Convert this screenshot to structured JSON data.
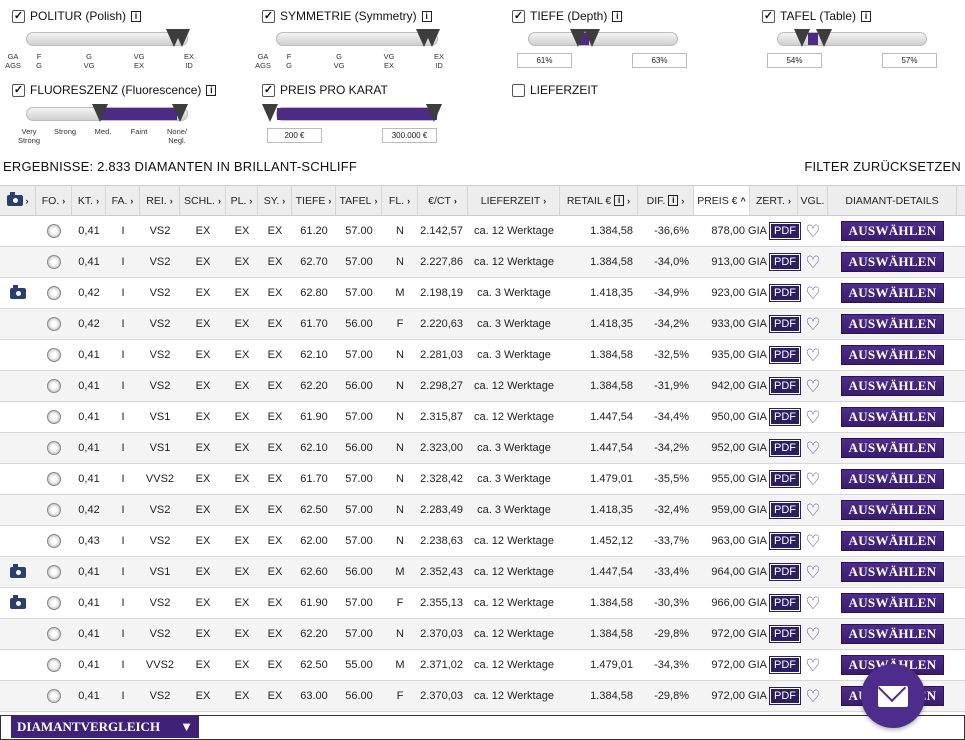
{
  "filters": {
    "politur": {
      "label": "POLITUR (Polish)",
      "ticks_top": [
        "GA",
        "F",
        "G",
        "VG",
        "EX"
      ],
      "ticks_bottom": [
        "AGS",
        "G",
        "VG",
        "EX",
        "ID"
      ]
    },
    "symmetrie": {
      "label": "SYMMETRIE (Symmetry)",
      "ticks_top": [
        "GA",
        "F",
        "G",
        "VG",
        "EX"
      ],
      "ticks_bottom": [
        "AGS",
        "G",
        "VG",
        "EX",
        "ID"
      ]
    },
    "tiefe": {
      "label": "TIEFE (Depth)",
      "min": "61%",
      "max": "63%"
    },
    "tafel": {
      "label": "TAFEL (Table)",
      "min": "54%",
      "max": "57%"
    },
    "fluoreszenz": {
      "label": "FLUORESZENZ (Fluorescence)",
      "ticks": [
        "Very\nStrong",
        "Strong",
        "Med.",
        "Faint",
        "None/\nNegl."
      ]
    },
    "preis": {
      "label": "PREIS PRO KARAT",
      "min": "200 €",
      "max": "300.000 €"
    },
    "lieferzeit": {
      "label": "LIEFERZEIT"
    }
  },
  "results_title": "ERGEBNISSE: 2.833 DIAMANTEN IN BRILLANT-SCHLIFF",
  "reset_label": "FILTER ZURÜCKSETZEN",
  "columns": [
    "FO.",
    "KT.",
    "FA.",
    "REI.",
    "SCHL.",
    "PL.",
    "SY.",
    "TIEFE",
    "TAFEL",
    "FL.",
    "€/CT",
    "LIEFERZEIT",
    "RETAIL €",
    "DIF.",
    "PREIS €",
    "ZERT.",
    "VGL.",
    "DIAMANT-DETAILS"
  ],
  "rows": [
    {
      "cam": false,
      "kt": "0,41",
      "fa": "I",
      "rei": "VS2",
      "schl": "EX",
      "pl": "EX",
      "sy": "EX",
      "tiefe": "61.20",
      "tafel": "57.00",
      "fl": "N",
      "ct": "2.142,57",
      "lz": "ca. 12 Werktage",
      "retail": "1.384,58",
      "dif": "-36,6%",
      "preis": "878,00"
    },
    {
      "cam": false,
      "kt": "0,41",
      "fa": "I",
      "rei": "VS2",
      "schl": "EX",
      "pl": "EX",
      "sy": "EX",
      "tiefe": "62.70",
      "tafel": "57.00",
      "fl": "N",
      "ct": "2.227,86",
      "lz": "ca. 12 Werktage",
      "retail": "1.384,58",
      "dif": "-34,0%",
      "preis": "913,00"
    },
    {
      "cam": true,
      "kt": "0,42",
      "fa": "I",
      "rei": "VS2",
      "schl": "EX",
      "pl": "EX",
      "sy": "EX",
      "tiefe": "62.80",
      "tafel": "57.00",
      "fl": "M",
      "ct": "2.198,19",
      "lz": "ca. 3 Werktage",
      "retail": "1.418,35",
      "dif": "-34,9%",
      "preis": "923,00"
    },
    {
      "cam": false,
      "kt": "0,42",
      "fa": "I",
      "rei": "VS2",
      "schl": "EX",
      "pl": "EX",
      "sy": "EX",
      "tiefe": "61.70",
      "tafel": "56.00",
      "fl": "F",
      "ct": "2.220,63",
      "lz": "ca. 3 Werktage",
      "retail": "1.418,35",
      "dif": "-34,2%",
      "preis": "933,00"
    },
    {
      "cam": false,
      "kt": "0,41",
      "fa": "I",
      "rei": "VS2",
      "schl": "EX",
      "pl": "EX",
      "sy": "EX",
      "tiefe": "62.10",
      "tafel": "57.00",
      "fl": "N",
      "ct": "2.281,03",
      "lz": "ca. 3 Werktage",
      "retail": "1.384,58",
      "dif": "-32,5%",
      "preis": "935,00"
    },
    {
      "cam": false,
      "kt": "0,41",
      "fa": "I",
      "rei": "VS2",
      "schl": "EX",
      "pl": "EX",
      "sy": "EX",
      "tiefe": "62.20",
      "tafel": "56.00",
      "fl": "N",
      "ct": "2.298,27",
      "lz": "ca. 12 Werktage",
      "retail": "1.384,58",
      "dif": "-31,9%",
      "preis": "942,00"
    },
    {
      "cam": false,
      "kt": "0,41",
      "fa": "I",
      "rei": "VS1",
      "schl": "EX",
      "pl": "EX",
      "sy": "EX",
      "tiefe": "61.90",
      "tafel": "57.00",
      "fl": "N",
      "ct": "2.315,87",
      "lz": "ca. 12 Werktage",
      "retail": "1.447,54",
      "dif": "-34,4%",
      "preis": "950,00"
    },
    {
      "cam": false,
      "kt": "0,41",
      "fa": "I",
      "rei": "VS1",
      "schl": "EX",
      "pl": "EX",
      "sy": "EX",
      "tiefe": "62.10",
      "tafel": "56.00",
      "fl": "N",
      "ct": "2.323,00",
      "lz": "ca. 3 Werktage",
      "retail": "1.447,54",
      "dif": "-34,2%",
      "preis": "952,00"
    },
    {
      "cam": false,
      "kt": "0,41",
      "fa": "I",
      "rei": "VVS2",
      "schl": "EX",
      "pl": "EX",
      "sy": "EX",
      "tiefe": "61.70",
      "tafel": "57.00",
      "fl": "N",
      "ct": "2.328,42",
      "lz": "ca. 3 Werktage",
      "retail": "1.479,01",
      "dif": "-35,5%",
      "preis": "955,00"
    },
    {
      "cam": false,
      "kt": "0,42",
      "fa": "I",
      "rei": "VS2",
      "schl": "EX",
      "pl": "EX",
      "sy": "EX",
      "tiefe": "62.50",
      "tafel": "57.00",
      "fl": "N",
      "ct": "2.283,49",
      "lz": "ca. 3 Werktage",
      "retail": "1.418,35",
      "dif": "-32,4%",
      "preis": "959,00"
    },
    {
      "cam": false,
      "kt": "0,43",
      "fa": "I",
      "rei": "VS2",
      "schl": "EX",
      "pl": "EX",
      "sy": "EX",
      "tiefe": "62.00",
      "tafel": "57.00",
      "fl": "N",
      "ct": "2.238,63",
      "lz": "ca. 12 Werktage",
      "retail": "1.452,12",
      "dif": "-33,7%",
      "preis": "963,00"
    },
    {
      "cam": true,
      "kt": "0,41",
      "fa": "I",
      "rei": "VS1",
      "schl": "EX",
      "pl": "EX",
      "sy": "EX",
      "tiefe": "62.60",
      "tafel": "56.00",
      "fl": "M",
      "ct": "2.352,43",
      "lz": "ca. 12 Werktage",
      "retail": "1.447,54",
      "dif": "-33,4%",
      "preis": "964,00"
    },
    {
      "cam": true,
      "kt": "0,41",
      "fa": "I",
      "rei": "VS2",
      "schl": "EX",
      "pl": "EX",
      "sy": "EX",
      "tiefe": "61.90",
      "tafel": "57.00",
      "fl": "F",
      "ct": "2.355,13",
      "lz": "ca. 12 Werktage",
      "retail": "1.384,58",
      "dif": "-30,3%",
      "preis": "966,00"
    },
    {
      "cam": false,
      "kt": "0,41",
      "fa": "I",
      "rei": "VS2",
      "schl": "EX",
      "pl": "EX",
      "sy": "EX",
      "tiefe": "62.20",
      "tafel": "57.00",
      "fl": "N",
      "ct": "2.370,03",
      "lz": "ca. 12 Werktage",
      "retail": "1.384,58",
      "dif": "-29,8%",
      "preis": "972,00"
    },
    {
      "cam": false,
      "kt": "0,41",
      "fa": "I",
      "rei": "VVS2",
      "schl": "EX",
      "pl": "EX",
      "sy": "EX",
      "tiefe": "62.50",
      "tafel": "55.00",
      "fl": "M",
      "ct": "2.371,02",
      "lz": "ca. 12 Werktage",
      "retail": "1.479,01",
      "dif": "-34,3%",
      "preis": "972,00"
    },
    {
      "cam": false,
      "kt": "0,41",
      "fa": "I",
      "rei": "VS2",
      "schl": "EX",
      "pl": "EX",
      "sy": "EX",
      "tiefe": "63.00",
      "tafel": "56.00",
      "fl": "F",
      "ct": "2.370,03",
      "lz": "ca. 12 Werktage",
      "retail": "1.384,58",
      "dif": "-29,8%",
      "preis": "972,00"
    }
  ],
  "cert_label": "GIA",
  "pdf_label": "PDF",
  "select_label": "AUSWÄHLEN",
  "compare_label": "DIAMANTVERGLEICH",
  "colors": {
    "accent": "#4e2c8c",
    "header_bg": "#ededed"
  }
}
